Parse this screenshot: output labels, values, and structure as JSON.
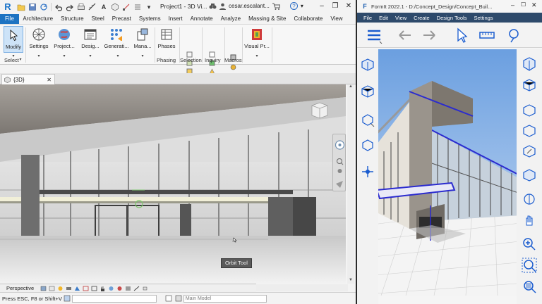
{
  "revit": {
    "qat_title": "Project1 - 3D Vi...",
    "user": "cesar.escalant...",
    "menu": [
      "File",
      "Architecture",
      "Structure",
      "Steel",
      "Precast",
      "Systems",
      "Insert",
      "Annotate",
      "Analyze",
      "Massing & Site",
      "Collaborate",
      "View"
    ],
    "ribbon_buttons": [
      "Modify",
      "Settings",
      "Project...",
      "Desig...",
      "Generati...",
      "Mana...",
      "Phases",
      "Visual Pr..."
    ],
    "group_labels": [
      "Select",
      "Phasing",
      "Selection",
      "Inquiry",
      "Macros"
    ],
    "view_tab": "{3D}",
    "orbit_tooltip": "Orbit Tool",
    "view_control": "Perspective",
    "status_message": "Press ESC, F8 or Shift+V",
    "model_field": "Main Model",
    "icons": [
      "revit-logo-icon",
      "open-icon",
      "save-icon",
      "sync-icon",
      "undo-icon",
      "redo-icon",
      "print-icon",
      "measure-icon",
      "search-icon",
      "cart-icon",
      "help-icon",
      "close-icon"
    ]
  },
  "formit": {
    "title": "FormIt 2022.1 - D:/Concept_Design/Concept_Buil...",
    "menu": [
      "File",
      "Edit",
      "View",
      "Create",
      "Design Tools",
      "Settings"
    ],
    "colors": {
      "menu_bg": "#2e4a6b",
      "accent": "#1a5ccf"
    }
  }
}
